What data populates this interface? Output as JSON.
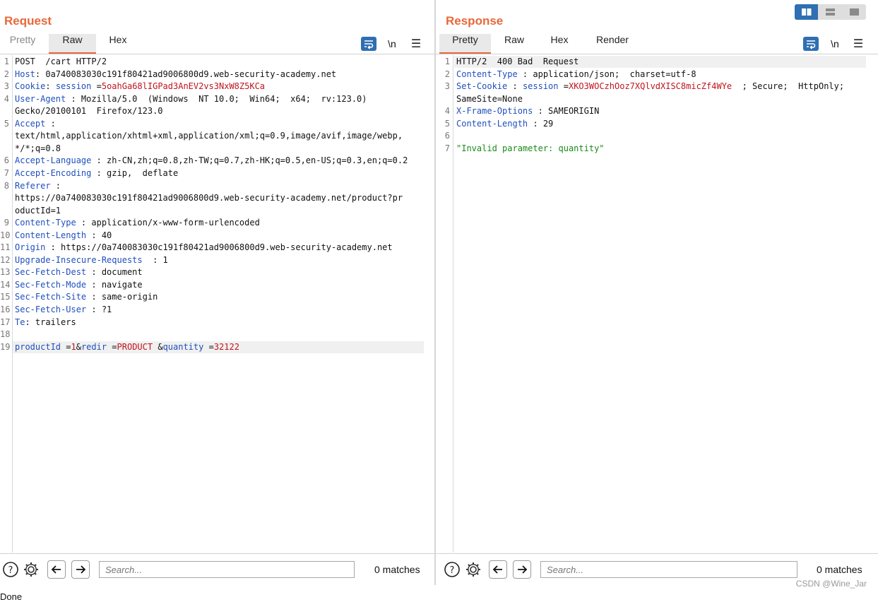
{
  "request": {
    "title": "Request",
    "tabs": [
      "Pretty",
      "Raw",
      "Hex"
    ],
    "active_tab": "Raw",
    "newline_label": "\\n",
    "lines": [
      {
        "n": "1",
        "parts": [
          [
            "t",
            "POST  /cart HTTP/2"
          ]
        ]
      },
      {
        "n": "2",
        "parts": [
          [
            "k",
            "Host"
          ],
          [
            "t",
            ": 0a740083030c191f80421ad9006800d9.web-security-academy.net"
          ]
        ]
      },
      {
        "n": "3",
        "parts": [
          [
            "k",
            "Cookie"
          ],
          [
            "t",
            ": "
          ],
          [
            "k",
            "session"
          ],
          [
            "t",
            " ="
          ],
          [
            "v",
            "5oahGa68lIGPad3AnEV2vs3NxW8Z5KCa"
          ]
        ]
      },
      {
        "n": "4",
        "parts": [
          [
            "k",
            "User-Agent"
          ],
          [
            "t",
            " : Mozilla/5.0  (Windows  NT 10.0;  Win64;  x64;  rv:123.0)"
          ]
        ]
      },
      {
        "n": "",
        "parts": [
          [
            "t",
            "Gecko/20100101  Firefox/123.0"
          ]
        ]
      },
      {
        "n": "5",
        "parts": [
          [
            "k",
            "Accept"
          ],
          [
            "t",
            " :"
          ]
        ]
      },
      {
        "n": "",
        "parts": [
          [
            "t",
            "text/html,application/xhtml+xml,application/xml;q=0.9,image/avif,image/webp,"
          ]
        ]
      },
      {
        "n": "",
        "parts": [
          [
            "t",
            "*/*;q=0.8"
          ]
        ]
      },
      {
        "n": "6",
        "parts": [
          [
            "k",
            "Accept-Language"
          ],
          [
            "t",
            " : zh-CN,zh;q=0.8,zh-TW;q=0.7,zh-HK;q=0.5,en-US;q=0.3,en;q=0.2"
          ]
        ]
      },
      {
        "n": "7",
        "parts": [
          [
            "k",
            "Accept-Encoding"
          ],
          [
            "t",
            " : gzip,  deflate"
          ]
        ]
      },
      {
        "n": "8",
        "parts": [
          [
            "k",
            "Referer"
          ],
          [
            "t",
            " :"
          ]
        ]
      },
      {
        "n": "",
        "parts": [
          [
            "t",
            "https://0a740083030c191f80421ad9006800d9.web-security-academy.net/product?pr"
          ]
        ]
      },
      {
        "n": "",
        "parts": [
          [
            "t",
            "oductId=1"
          ]
        ]
      },
      {
        "n": "9",
        "parts": [
          [
            "k",
            "Content-Type"
          ],
          [
            "t",
            " : application/x-www-form-urlencoded"
          ]
        ]
      },
      {
        "n": "10",
        "parts": [
          [
            "k",
            "Content-Length"
          ],
          [
            "t",
            " : 40"
          ]
        ]
      },
      {
        "n": "11",
        "parts": [
          [
            "k",
            "Origin"
          ],
          [
            "t",
            " : https://0a740083030c191f80421ad9006800d9.web-security-academy.net"
          ]
        ]
      },
      {
        "n": "12",
        "parts": [
          [
            "k",
            "Upgrade-Insecure-Requests"
          ],
          [
            "t",
            "  : 1"
          ]
        ]
      },
      {
        "n": "13",
        "parts": [
          [
            "k",
            "Sec-Fetch-Dest"
          ],
          [
            "t",
            " : document"
          ]
        ]
      },
      {
        "n": "14",
        "parts": [
          [
            "k",
            "Sec-Fetch-Mode"
          ],
          [
            "t",
            " : navigate"
          ]
        ]
      },
      {
        "n": "15",
        "parts": [
          [
            "k",
            "Sec-Fetch-Site"
          ],
          [
            "t",
            " : same-origin"
          ]
        ]
      },
      {
        "n": "16",
        "parts": [
          [
            "k",
            "Sec-Fetch-User"
          ],
          [
            "t",
            " : ?1"
          ]
        ]
      },
      {
        "n": "17",
        "parts": [
          [
            "k",
            "Te"
          ],
          [
            "t",
            ": trailers"
          ]
        ]
      },
      {
        "n": "18",
        "parts": []
      },
      {
        "n": "19",
        "parts": [
          [
            "k",
            "productId"
          ],
          [
            "t",
            " ="
          ],
          [
            "v",
            "1"
          ],
          [
            "t",
            "&"
          ],
          [
            "k",
            "redir"
          ],
          [
            "t",
            " ="
          ],
          [
            "v",
            "PRODUCT"
          ],
          [
            "t",
            " &"
          ],
          [
            "k",
            "quantity"
          ],
          [
            "t",
            " ="
          ],
          [
            "v",
            "32122"
          ]
        ]
      }
    ],
    "search": {
      "placeholder": "Search...",
      "matches": "0 matches"
    }
  },
  "response": {
    "title": "Response",
    "tabs": [
      "Pretty",
      "Raw",
      "Hex",
      "Render"
    ],
    "active_tab": "Pretty",
    "newline_label": "\\n",
    "lines": [
      {
        "n": "1",
        "parts": [
          [
            "t",
            "HTTP/2  400 Bad  Request"
          ]
        ]
      },
      {
        "n": "2",
        "parts": [
          [
            "k",
            "Content-Type"
          ],
          [
            "t",
            " : application/json;  charset=utf-8"
          ]
        ]
      },
      {
        "n": "3",
        "parts": [
          [
            "k",
            "Set-Cookie"
          ],
          [
            "t",
            " : "
          ],
          [
            "k",
            "session"
          ],
          [
            "t",
            " ="
          ],
          [
            "v",
            "XKO3WOCzhOoz7XQlvdXISC8micZf4WYe"
          ],
          [
            "t",
            "  ; Secure;  HttpOnly;"
          ]
        ]
      },
      {
        "n": "",
        "parts": [
          [
            "t",
            "SameSite=None"
          ]
        ]
      },
      {
        "n": "4",
        "parts": [
          [
            "k",
            "X-Frame-Options"
          ],
          [
            "t",
            " : SAMEORIGIN"
          ]
        ]
      },
      {
        "n": "5",
        "parts": [
          [
            "k",
            "Content-Length"
          ],
          [
            "t",
            " : 29"
          ]
        ]
      },
      {
        "n": "6",
        "parts": []
      },
      {
        "n": "7",
        "parts": [
          [
            "g",
            "\"Invalid parameter: quantity\""
          ]
        ]
      }
    ],
    "search": {
      "placeholder": "Search...",
      "matches": "0 matches"
    }
  },
  "status": {
    "text": "Done"
  },
  "watermark": "CSDN @Wine_Jar",
  "colors": {
    "accent": "#e8683a",
    "header": "#1f4fbf",
    "value": "#c0141f",
    "string": "#1a8a1a",
    "button_blue": "#2f6fb3"
  },
  "icons": [
    "wrap-lines-icon",
    "menu-icon",
    "help-icon",
    "settings-gear-icon",
    "arrow-left-icon",
    "arrow-right-icon",
    "layout-side-by-side-icon",
    "layout-stacked-icon",
    "layout-single-icon"
  ]
}
